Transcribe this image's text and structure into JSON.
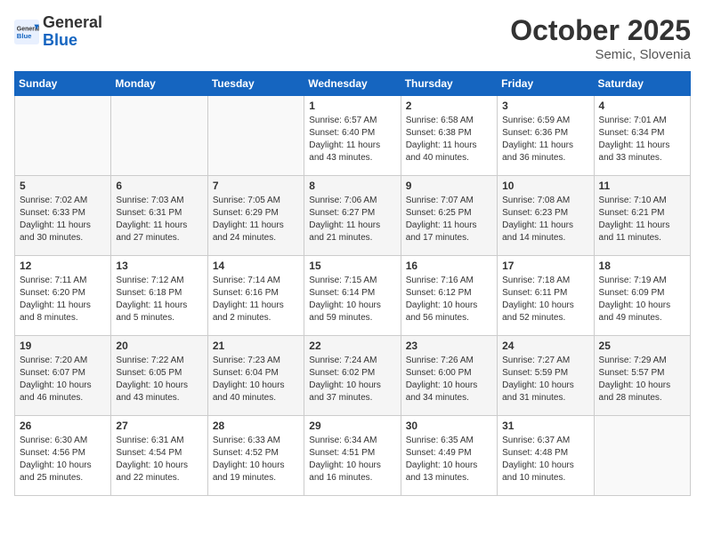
{
  "header": {
    "logo_general": "General",
    "logo_blue": "Blue",
    "month_title": "October 2025",
    "location": "Semic, Slovenia"
  },
  "days_of_week": [
    "Sunday",
    "Monday",
    "Tuesday",
    "Wednesday",
    "Thursday",
    "Friday",
    "Saturday"
  ],
  "weeks": [
    [
      {
        "day": "",
        "info": ""
      },
      {
        "day": "",
        "info": ""
      },
      {
        "day": "",
        "info": ""
      },
      {
        "day": "1",
        "info": "Sunrise: 6:57 AM\nSunset: 6:40 PM\nDaylight: 11 hours and 43 minutes."
      },
      {
        "day": "2",
        "info": "Sunrise: 6:58 AM\nSunset: 6:38 PM\nDaylight: 11 hours and 40 minutes."
      },
      {
        "day": "3",
        "info": "Sunrise: 6:59 AM\nSunset: 6:36 PM\nDaylight: 11 hours and 36 minutes."
      },
      {
        "day": "4",
        "info": "Sunrise: 7:01 AM\nSunset: 6:34 PM\nDaylight: 11 hours and 33 minutes."
      }
    ],
    [
      {
        "day": "5",
        "info": "Sunrise: 7:02 AM\nSunset: 6:33 PM\nDaylight: 11 hours and 30 minutes."
      },
      {
        "day": "6",
        "info": "Sunrise: 7:03 AM\nSunset: 6:31 PM\nDaylight: 11 hours and 27 minutes."
      },
      {
        "day": "7",
        "info": "Sunrise: 7:05 AM\nSunset: 6:29 PM\nDaylight: 11 hours and 24 minutes."
      },
      {
        "day": "8",
        "info": "Sunrise: 7:06 AM\nSunset: 6:27 PM\nDaylight: 11 hours and 21 minutes."
      },
      {
        "day": "9",
        "info": "Sunrise: 7:07 AM\nSunset: 6:25 PM\nDaylight: 11 hours and 17 minutes."
      },
      {
        "day": "10",
        "info": "Sunrise: 7:08 AM\nSunset: 6:23 PM\nDaylight: 11 hours and 14 minutes."
      },
      {
        "day": "11",
        "info": "Sunrise: 7:10 AM\nSunset: 6:21 PM\nDaylight: 11 hours and 11 minutes."
      }
    ],
    [
      {
        "day": "12",
        "info": "Sunrise: 7:11 AM\nSunset: 6:20 PM\nDaylight: 11 hours and 8 minutes."
      },
      {
        "day": "13",
        "info": "Sunrise: 7:12 AM\nSunset: 6:18 PM\nDaylight: 11 hours and 5 minutes."
      },
      {
        "day": "14",
        "info": "Sunrise: 7:14 AM\nSunset: 6:16 PM\nDaylight: 11 hours and 2 minutes."
      },
      {
        "day": "15",
        "info": "Sunrise: 7:15 AM\nSunset: 6:14 PM\nDaylight: 10 hours and 59 minutes."
      },
      {
        "day": "16",
        "info": "Sunrise: 7:16 AM\nSunset: 6:12 PM\nDaylight: 10 hours and 56 minutes."
      },
      {
        "day": "17",
        "info": "Sunrise: 7:18 AM\nSunset: 6:11 PM\nDaylight: 10 hours and 52 minutes."
      },
      {
        "day": "18",
        "info": "Sunrise: 7:19 AM\nSunset: 6:09 PM\nDaylight: 10 hours and 49 minutes."
      }
    ],
    [
      {
        "day": "19",
        "info": "Sunrise: 7:20 AM\nSunset: 6:07 PM\nDaylight: 10 hours and 46 minutes."
      },
      {
        "day": "20",
        "info": "Sunrise: 7:22 AM\nSunset: 6:05 PM\nDaylight: 10 hours and 43 minutes."
      },
      {
        "day": "21",
        "info": "Sunrise: 7:23 AM\nSunset: 6:04 PM\nDaylight: 10 hours and 40 minutes."
      },
      {
        "day": "22",
        "info": "Sunrise: 7:24 AM\nSunset: 6:02 PM\nDaylight: 10 hours and 37 minutes."
      },
      {
        "day": "23",
        "info": "Sunrise: 7:26 AM\nSunset: 6:00 PM\nDaylight: 10 hours and 34 minutes."
      },
      {
        "day": "24",
        "info": "Sunrise: 7:27 AM\nSunset: 5:59 PM\nDaylight: 10 hours and 31 minutes."
      },
      {
        "day": "25",
        "info": "Sunrise: 7:29 AM\nSunset: 5:57 PM\nDaylight: 10 hours and 28 minutes."
      }
    ],
    [
      {
        "day": "26",
        "info": "Sunrise: 6:30 AM\nSunset: 4:56 PM\nDaylight: 10 hours and 25 minutes."
      },
      {
        "day": "27",
        "info": "Sunrise: 6:31 AM\nSunset: 4:54 PM\nDaylight: 10 hours and 22 minutes."
      },
      {
        "day": "28",
        "info": "Sunrise: 6:33 AM\nSunset: 4:52 PM\nDaylight: 10 hours and 19 minutes."
      },
      {
        "day": "29",
        "info": "Sunrise: 6:34 AM\nSunset: 4:51 PM\nDaylight: 10 hours and 16 minutes."
      },
      {
        "day": "30",
        "info": "Sunrise: 6:35 AM\nSunset: 4:49 PM\nDaylight: 10 hours and 13 minutes."
      },
      {
        "day": "31",
        "info": "Sunrise: 6:37 AM\nSunset: 4:48 PM\nDaylight: 10 hours and 10 minutes."
      },
      {
        "day": "",
        "info": ""
      }
    ]
  ]
}
